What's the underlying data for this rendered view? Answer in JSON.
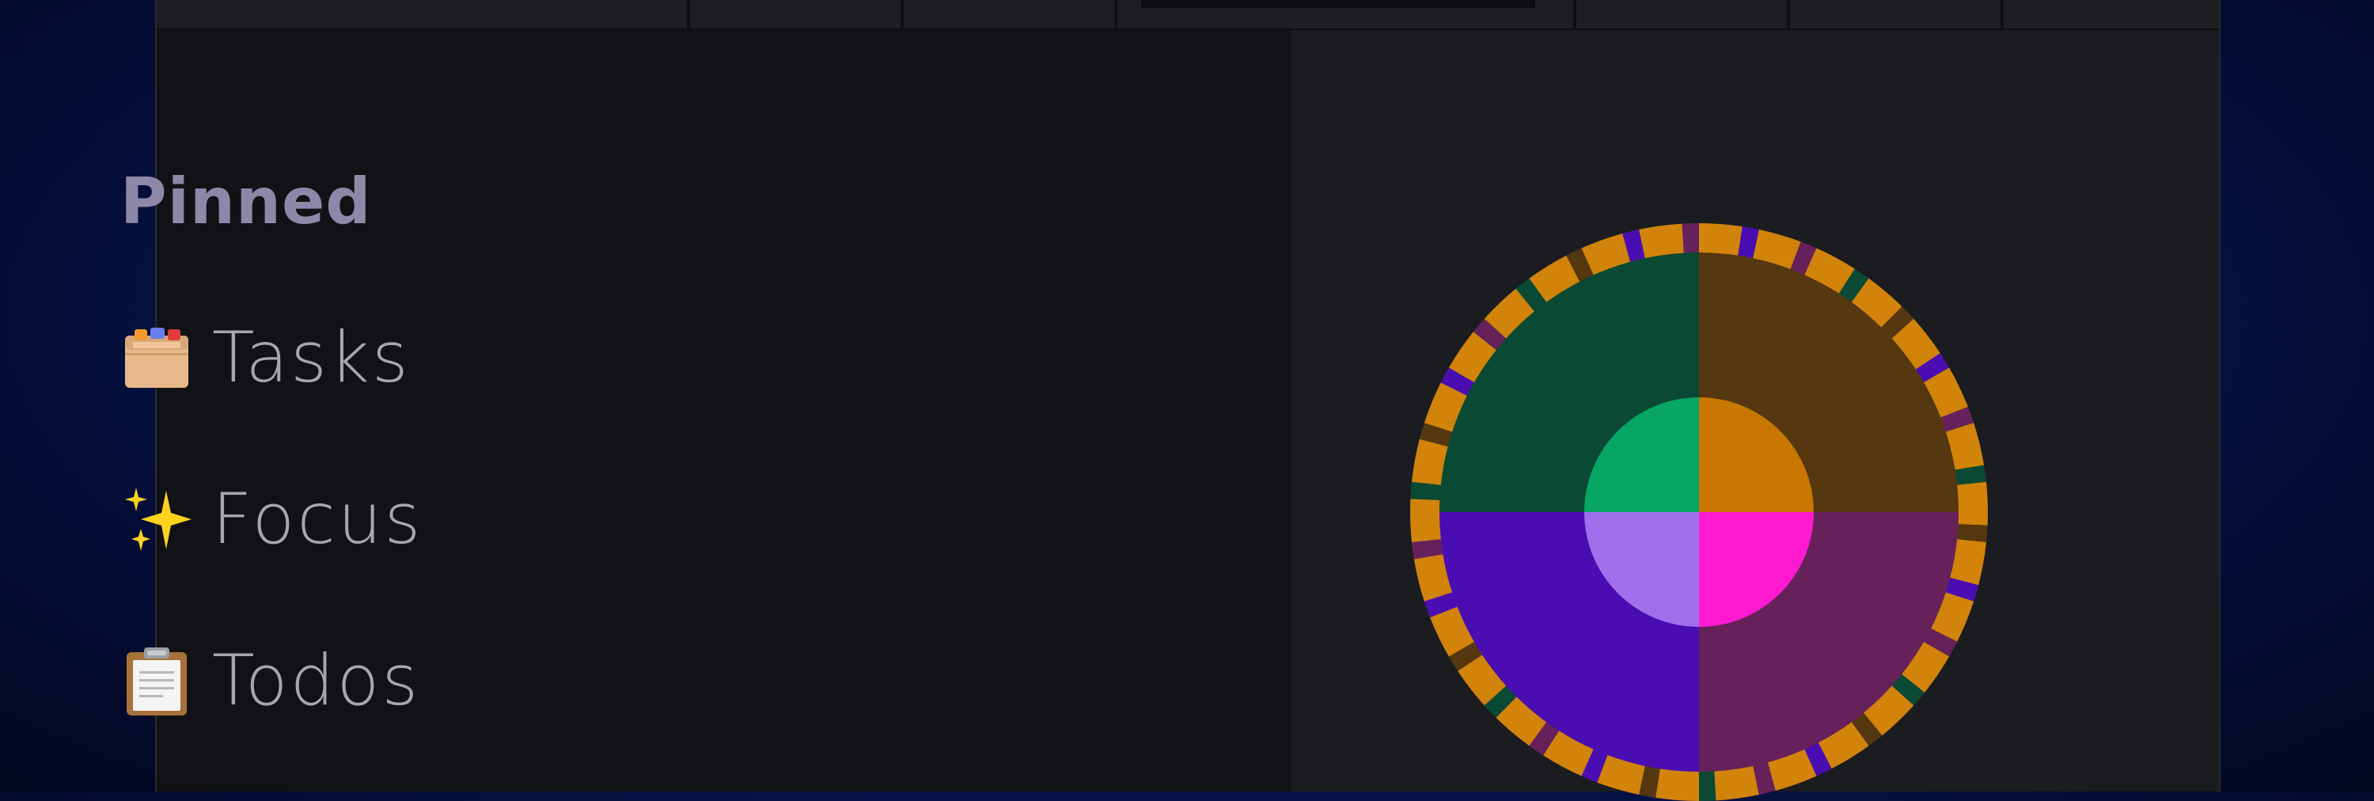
{
  "pinned": {
    "title": "Pinned",
    "items": [
      {
        "label": "Tasks",
        "icon": "card-file-box-icon"
      },
      {
        "label": "Focus",
        "icon": "sparkles-icon"
      },
      {
        "label": "Todos",
        "icon": "clipboard-icon"
      }
    ]
  },
  "wheel": {
    "icon": "color-wheel-icon",
    "quadrant_colors": {
      "top_left": "#0a4a35",
      "top_right": "#553710",
      "bottom_left": "#4a0db2",
      "bottom_right": "#67215a"
    },
    "center_colors": {
      "top_left": "#07a566",
      "top_right": "#c87800",
      "bottom_left": "#a070ec",
      "bottom_right": "#ff1ad0"
    },
    "ring_colors": {
      "dash": "#d1830a",
      "gap_colors": [
        "#4a0db2",
        "#67215a",
        "#0a4a35",
        "#553710"
      ]
    }
  },
  "colors": {
    "background": "#081650",
    "window": "#101114",
    "right_pane": "#1b1c20",
    "title_text": "#8e88a8",
    "item_text": "#a6a6ae"
  }
}
